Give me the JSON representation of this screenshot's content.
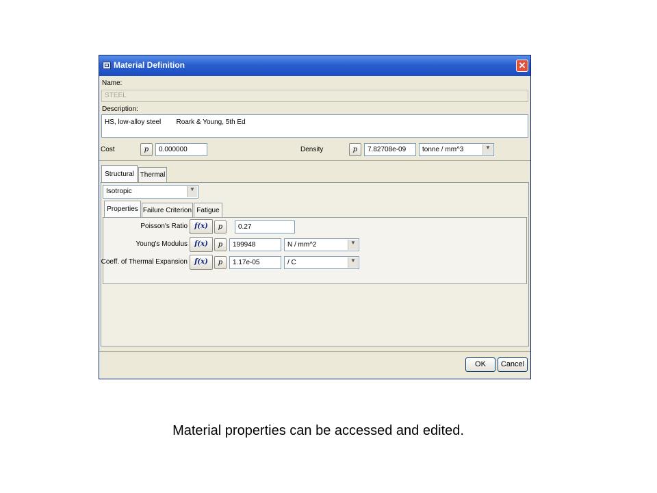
{
  "window": {
    "title": "Material Definition",
    "close_glyph": "✕"
  },
  "name": {
    "label": "Name:",
    "value": "STEEL"
  },
  "description": {
    "label": "Description:",
    "value": "HS, low-alloy steel        Roark & Young, 5th Ed"
  },
  "cost": {
    "label": "Cost",
    "p_label": "p",
    "value": "0.000000"
  },
  "density": {
    "label": "Density",
    "p_label": "p",
    "value": "7.82708e-09",
    "unit": "tonne / mm^3"
  },
  "outer_tabs": [
    {
      "label": "Structural"
    },
    {
      "label": "Thermal"
    }
  ],
  "model_select": {
    "value": "Isotropic"
  },
  "inner_tabs": [
    {
      "label": "Properties"
    },
    {
      "label": "Failure Criterion"
    },
    {
      "label": "Fatigue"
    }
  ],
  "properties": [
    {
      "label": "Poisson's Ratio",
      "fx_label": "f(x)",
      "p_label": "p",
      "value": "0.27"
    },
    {
      "label": "Young's Modulus",
      "fx_label": "f(x)",
      "p_label": "p",
      "value": "199948",
      "unit": "N / mm^2"
    },
    {
      "label": "Coeff. of Thermal Expansion",
      "fx_label": "f(x)",
      "p_label": "p",
      "value": "1.17e-05",
      "unit": "/ C"
    }
  ],
  "buttons": {
    "ok": "OK",
    "cancel": "Cancel"
  },
  "caption": "Material properties can be accessed and edited.",
  "icons": {
    "dropdown": "▼"
  },
  "colors": {
    "titlebar": "#2a5fd0",
    "dialog_bg": "#ece9d8",
    "close": "#e0503a"
  }
}
